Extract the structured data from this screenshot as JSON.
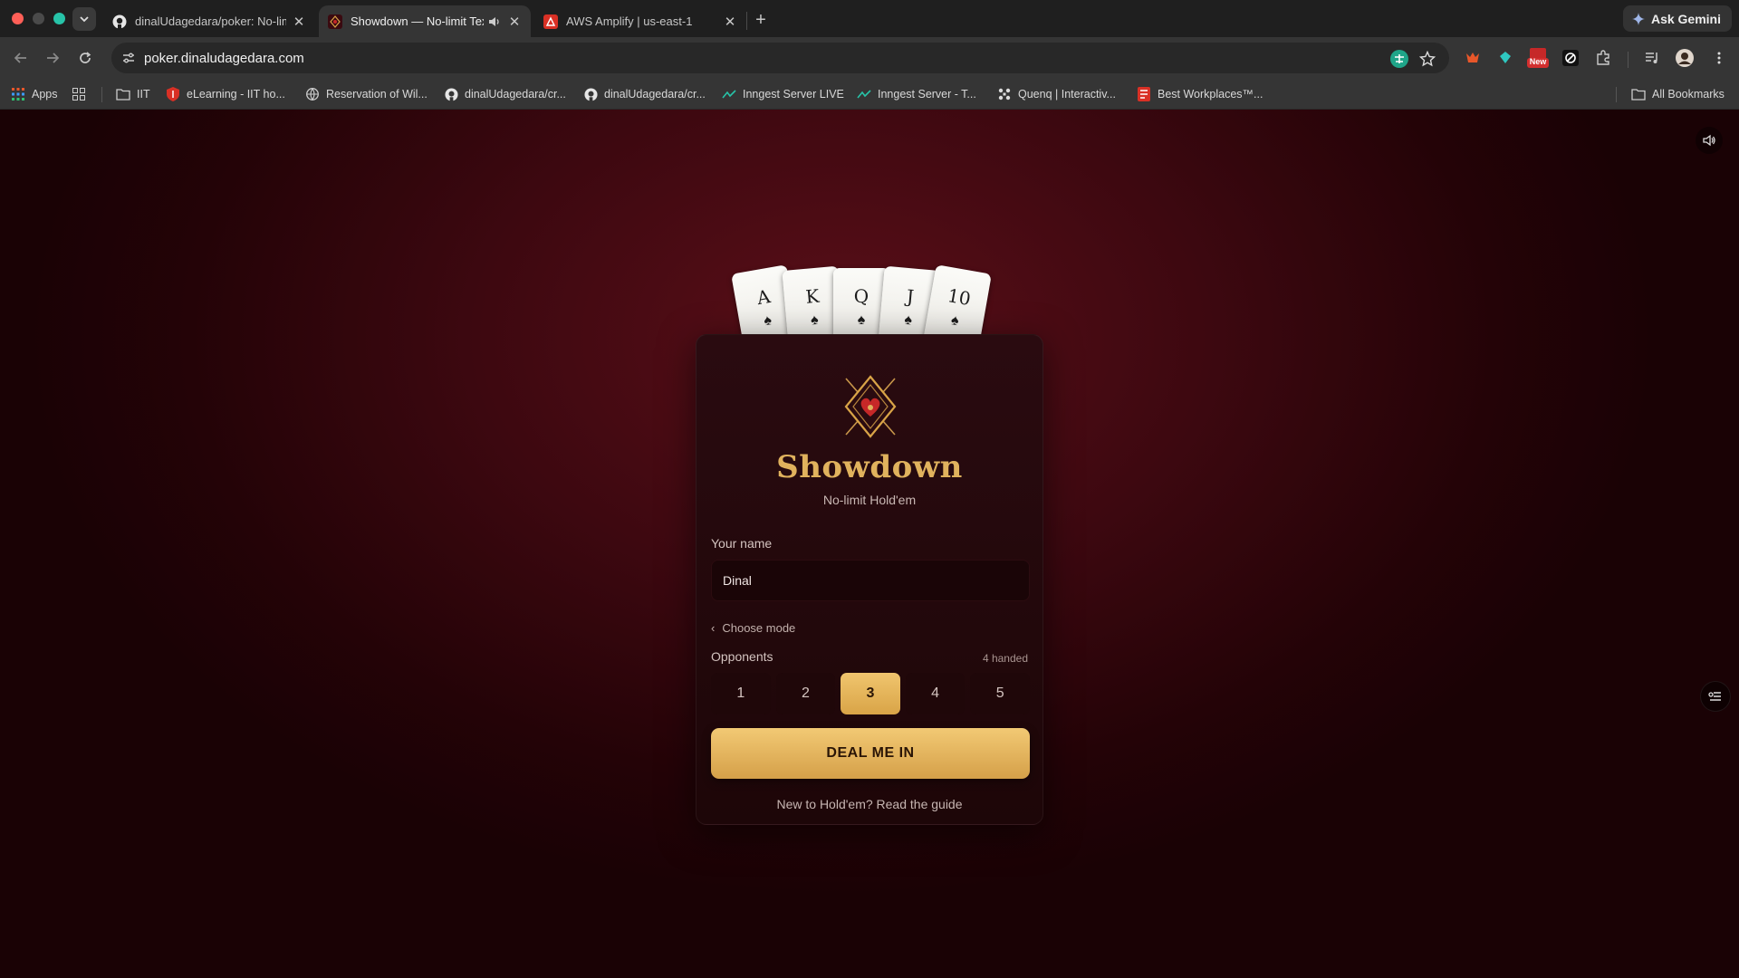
{
  "browser": {
    "tabs": [
      {
        "title": "dinalUdagedara/poker: No-lim",
        "favicon": "github-icon",
        "active": false
      },
      {
        "title": "Showdown — No-limit Tex",
        "favicon": "showdown-icon",
        "active": true,
        "audio": "speaker-icon"
      },
      {
        "title": "AWS Amplify | us-east-1",
        "favicon": "aws-amplify-icon",
        "active": false
      }
    ],
    "new_tab_label": "+",
    "ask_gemini": "Ask Gemini",
    "url": "poker.dinaludagedara.com",
    "extension_badge": "New",
    "bookmarks": [
      {
        "label": "Apps",
        "icon": "apps-grid-icon"
      },
      {
        "label": "",
        "icon": "tab-groups-icon"
      },
      {
        "label": "IIT",
        "icon": "folder-icon"
      },
      {
        "label": "eLearning - IIT ho...",
        "icon": "shield-red-icon"
      },
      {
        "label": "Reservation of Wil...",
        "icon": "globe-icon"
      },
      {
        "label": "dinalUdagedara/cr...",
        "icon": "github-icon"
      },
      {
        "label": "dinalUdagedara/cr...",
        "icon": "github-icon"
      },
      {
        "label": "Inngest Server LIVE",
        "icon": "inngest-icon"
      },
      {
        "label": "Inngest Server - T...",
        "icon": "inngest-icon"
      },
      {
        "label": "Quenq | Interactiv...",
        "icon": "quenq-icon"
      },
      {
        "label": "Best Workplaces™...",
        "icon": "best-workplaces-icon"
      }
    ],
    "all_bookmarks": "All Bookmarks"
  },
  "app": {
    "cards": [
      {
        "rank": "A",
        "suit": "♠"
      },
      {
        "rank": "K",
        "suit": "♠"
      },
      {
        "rank": "Q",
        "suit": "♠"
      },
      {
        "rank": "J",
        "suit": "♠"
      },
      {
        "rank": "10",
        "suit": "♠"
      }
    ],
    "brand": "Showdown",
    "subtitle": "No-limit Hold'em",
    "name_label": "Your name",
    "name_value": "Dinal",
    "choose_mode": "Choose mode",
    "opponents_label": "Opponents",
    "handed_label": "4 handed",
    "opponent_options": [
      "1",
      "2",
      "3",
      "4",
      "5"
    ],
    "selected_opponents": "3",
    "deal_button": "DEAL ME IN",
    "guide_link": "New to Hold'em? Read the guide"
  },
  "colors": {
    "accent_gold": "#e0b25d",
    "background_red": "#3d0810",
    "panel_bg": "#2a0b10"
  }
}
